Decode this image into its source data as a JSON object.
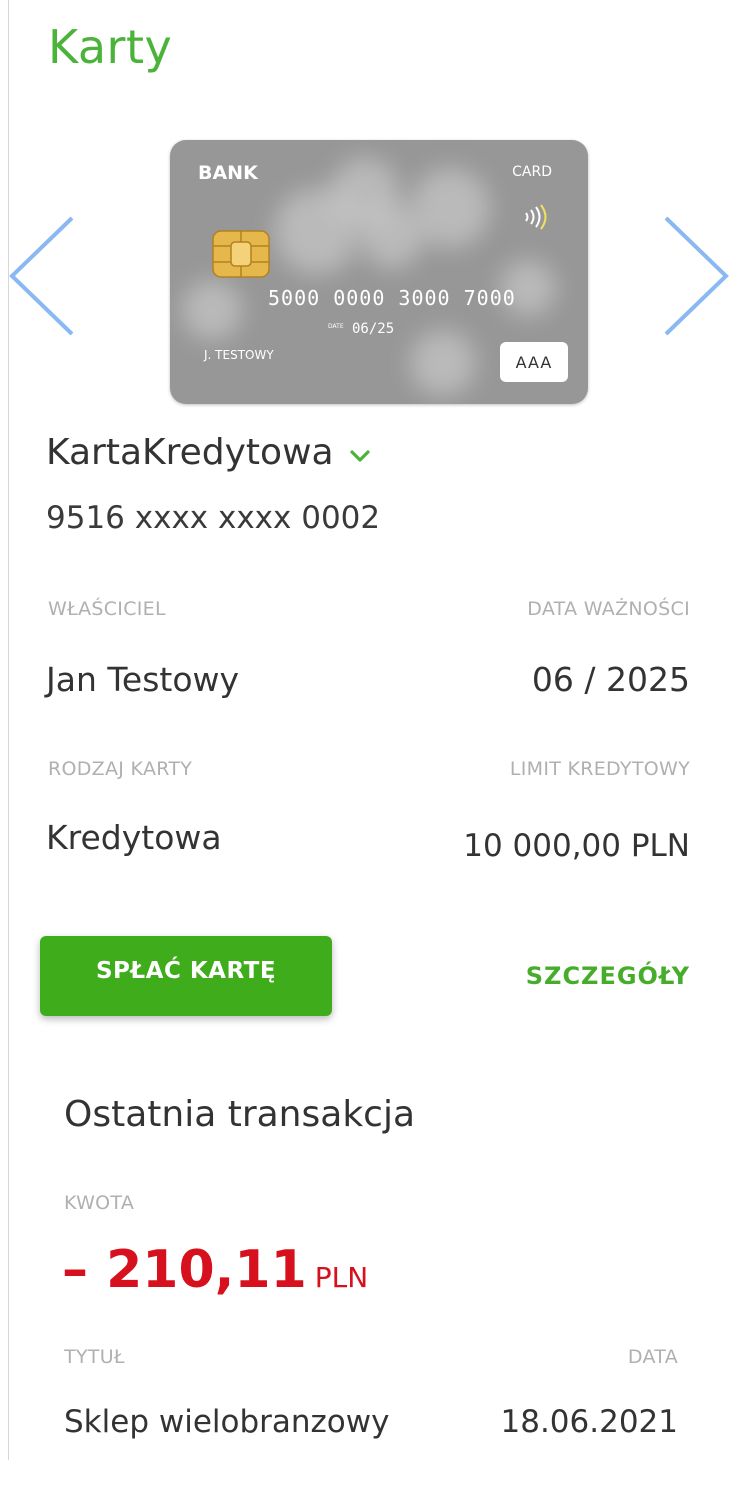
{
  "section_title": "Karty",
  "carousel": {
    "card": {
      "bank_label": "BANK",
      "brand_label": "CARD",
      "number": "5000 0000 3000 7000",
      "valid_label": "DATE",
      "expiry": "06/25",
      "holder": "J. TESTOWY",
      "badge": "AAA"
    }
  },
  "card_name": "KartaKredytowa",
  "card_number_masked": "9516 xxxx xxxx 0002",
  "fields": {
    "owner_label": "WŁAŚCICIEL",
    "owner_value": "Jan Testowy",
    "expiry_label": "DATA WAŻNOŚCI",
    "expiry_value": "06 / 2025",
    "type_label": "RODZAJ KARTY",
    "type_value": "Kredytowa",
    "limit_label": "LIMIT KREDYTOWY",
    "limit_value": "10 000,00 PLN"
  },
  "actions": {
    "pay_label": "SPŁAĆ KARTĘ",
    "details_label": "SZCZEGÓŁY"
  },
  "last_transaction": {
    "title": "Ostatnia transakcja",
    "amount_label": "KWOTA",
    "amount": "– 210,11",
    "currency": "PLN",
    "title_label": "TYTUŁ",
    "title_value": "Sklep wielobranzowy",
    "date_label": "DATA",
    "date_value": "18.06.2021"
  },
  "colors": {
    "accent_green": "#4bb33a",
    "button_green": "#3fac1b",
    "negative_red": "#d7101e",
    "arrow_blue": "#8ab8f2"
  },
  "icons": {
    "prev": "chevron-left-icon",
    "next": "chevron-right-icon",
    "dropdown": "chevron-down-icon",
    "contactless": "contactless-icon",
    "chip": "chip-icon"
  }
}
